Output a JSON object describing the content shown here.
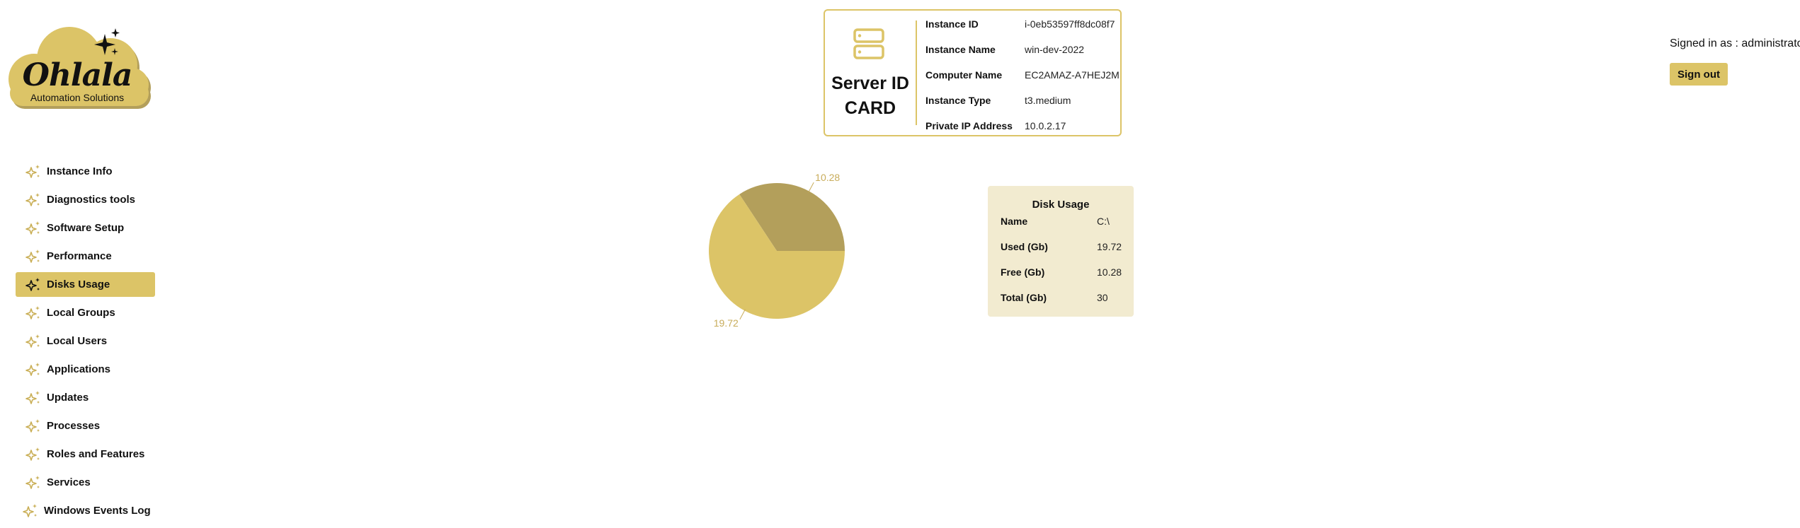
{
  "brand": {
    "name": "Ohlala",
    "tagline": "Automation Solutions",
    "accent_color": "#dcc467",
    "dark_accent_color": "#b39f5b",
    "panel_color": "#f2ebd0"
  },
  "sidebar": {
    "items": [
      {
        "label": "Instance Info",
        "icon": "sparkle-icon"
      },
      {
        "label": "Diagnostics tools",
        "icon": "sparkle-icon"
      },
      {
        "label": "Software Setup",
        "icon": "sparkle-icon"
      },
      {
        "label": "Performance",
        "icon": "sparkle-icon"
      },
      {
        "label": "Disks Usage",
        "icon": "sparkle-icon",
        "active": true
      },
      {
        "label": "Local Groups",
        "icon": "sparkle-icon"
      },
      {
        "label": "Local Users",
        "icon": "sparkle-icon"
      },
      {
        "label": "Applications",
        "icon": "sparkle-icon"
      },
      {
        "label": "Updates",
        "icon": "sparkle-icon"
      },
      {
        "label": "Processes",
        "icon": "sparkle-icon"
      },
      {
        "label": "Roles and Features",
        "icon": "sparkle-icon"
      },
      {
        "label": "Services",
        "icon": "sparkle-icon"
      },
      {
        "label": "Windows Events Log",
        "icon": "sparkle-icon"
      }
    ]
  },
  "id_card": {
    "title_line1": "Server ID",
    "title_line2": "CARD",
    "icon": "server-icon",
    "rows": [
      {
        "label": "Instance ID",
        "value": "i-0eb53597ff8dc08f7"
      },
      {
        "label": "Instance Name",
        "value": "win-dev-2022"
      },
      {
        "label": "Computer Name",
        "value": "EC2AMAZ-A7HEJ2M"
      },
      {
        "label": "Instance Type",
        "value": "t3.medium"
      },
      {
        "label": "Private IP Address",
        "value": "10.0.2.17"
      }
    ]
  },
  "session": {
    "signed_in_text": "Signed in as : administrator",
    "sign_out_label": "Sign out"
  },
  "chart_data": {
    "type": "pie",
    "slices": [
      {
        "label": "10.28",
        "value": 10.28,
        "color": "#b39f5b"
      },
      {
        "label": "19.72",
        "value": 19.72,
        "color": "#dcc467"
      }
    ],
    "label_color": "#c8ac5a"
  },
  "disk_usage": {
    "title": "Disk Usage",
    "rows": [
      {
        "label": "Name",
        "value": "C:\\"
      },
      {
        "label": "Used (Gb)",
        "value": "19.72"
      },
      {
        "label": "Free (Gb)",
        "value": "10.28"
      },
      {
        "label": "Total (Gb)",
        "value": "30"
      }
    ]
  }
}
